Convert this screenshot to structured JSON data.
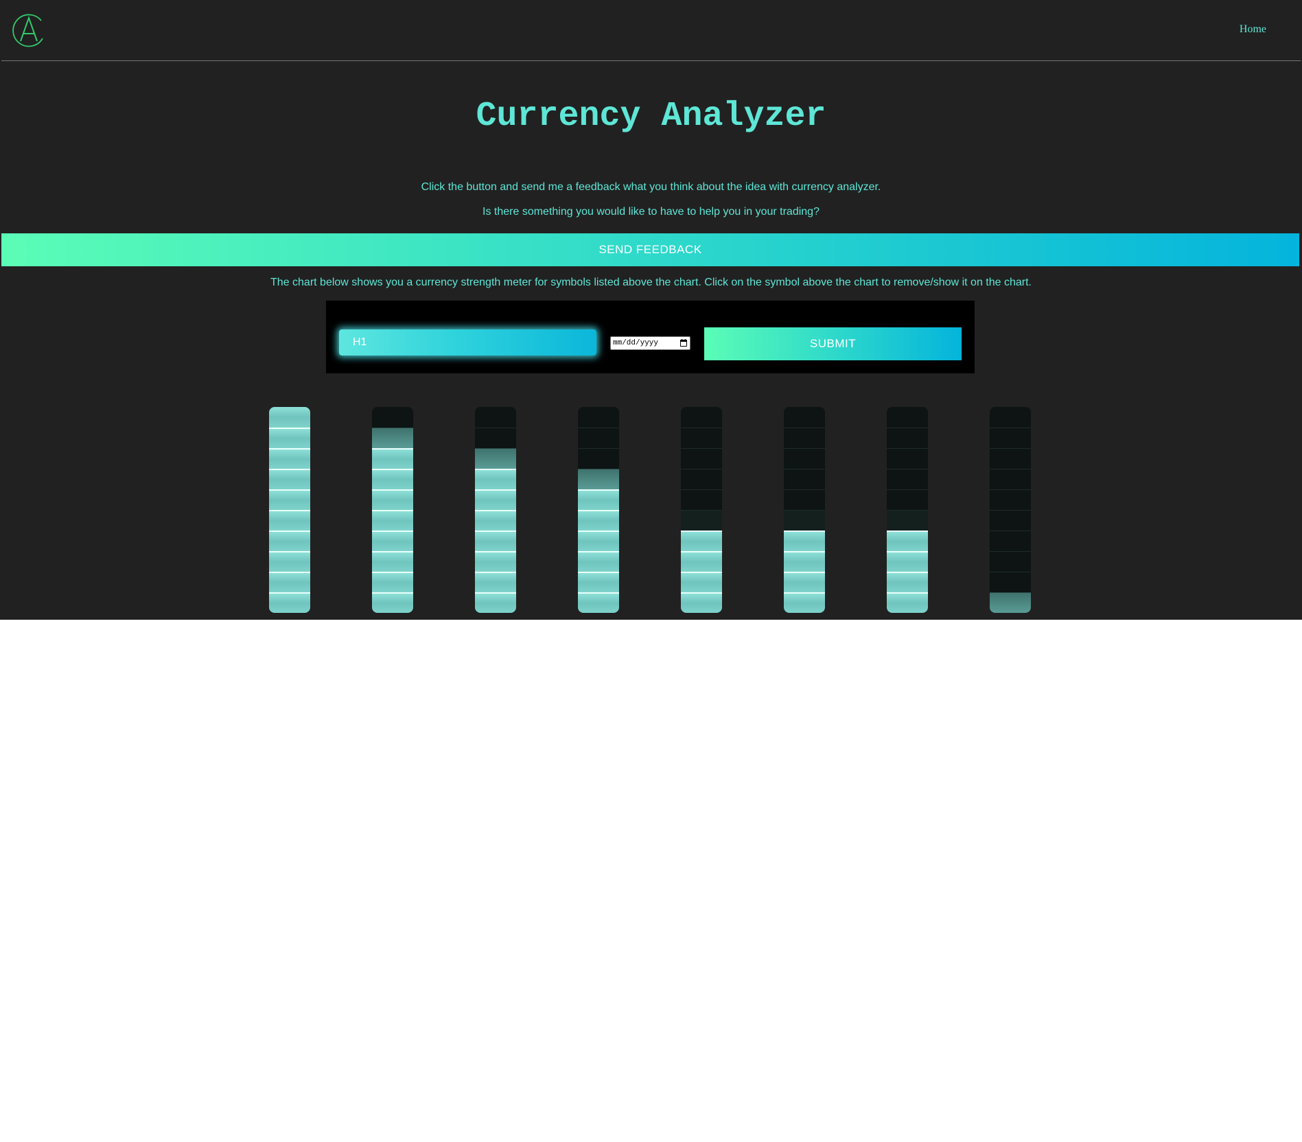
{
  "nav": {
    "logo_letter": "A",
    "home_label": "Home"
  },
  "page": {
    "title": "Currency Analyzer",
    "intro_line1": "Click the button and send me a feedback what you think about the idea with currency analyzer.",
    "intro_line2": "Is there something you would like to have to help you in your trading?",
    "feedback_button": "SEND FEEDBACK",
    "chart_description": "The chart below shows you a currency strength meter for symbols listed above the chart. Click on the symbol above the chart to remove/show it on the chart."
  },
  "controls": {
    "timeframe_value": "H1",
    "date_placeholder": "mm/dd/yyyy",
    "submit_label": "SUBMIT"
  },
  "colors": {
    "background": "#212121",
    "accent_text": "#5ee6d6",
    "gradient_start": "#5bfdb6",
    "gradient_end": "#04b4dc",
    "meter_fill": "#7ed2cb",
    "meter_empty": "#0d1413"
  },
  "chart_data": {
    "type": "bar",
    "segments_per_meter": 10,
    "ylim": [
      0,
      10
    ],
    "values": [
      10,
      8,
      7,
      6,
      4,
      4,
      4,
      0
    ],
    "partial_segments": [
      0,
      1,
      1,
      1,
      1,
      1,
      1,
      1
    ]
  }
}
